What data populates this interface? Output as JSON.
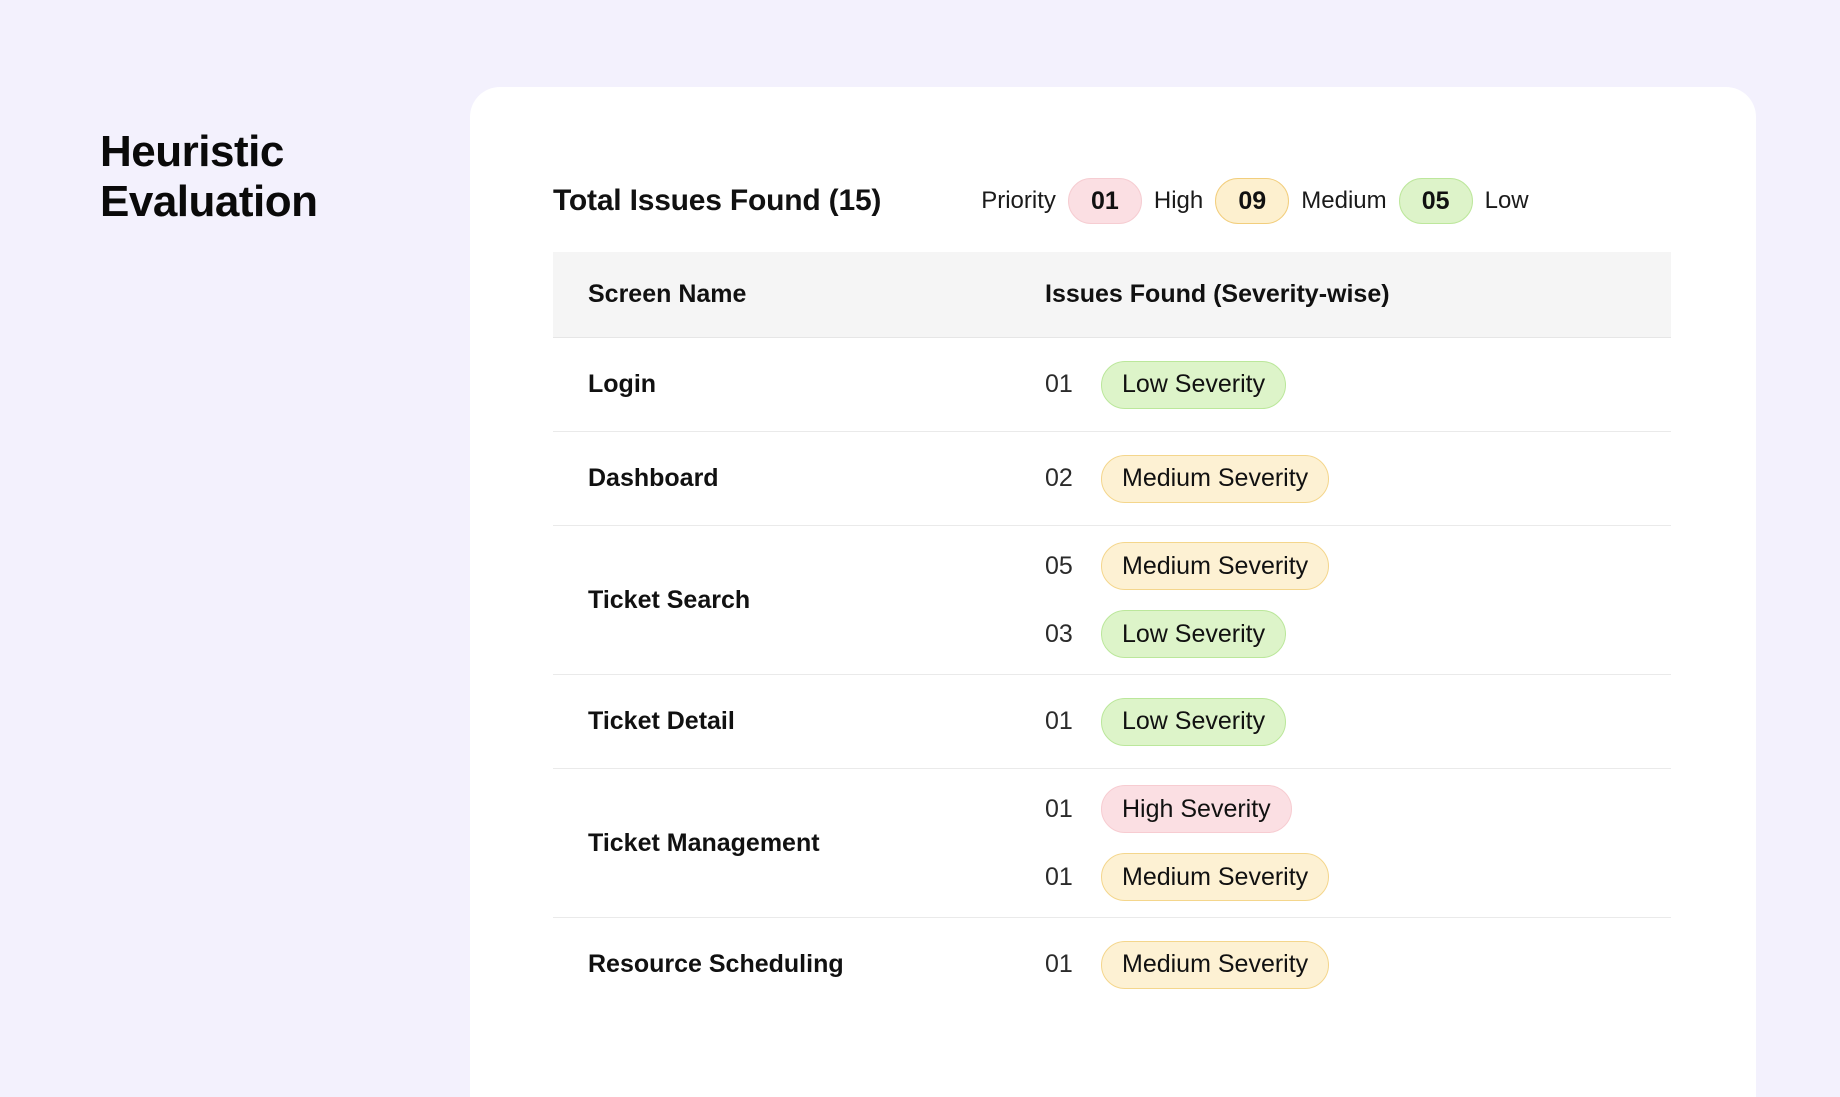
{
  "page": {
    "title": "Heuristic Evaluation",
    "background_color": "#F3F1FD"
  },
  "card": {
    "summary_title": "Total Issues Found (15)",
    "legend": {
      "label": "Priority",
      "items": [
        {
          "count": "01",
          "label": "High",
          "severity": "high",
          "color": "#FBDFE3"
        },
        {
          "count": "09",
          "label": "Medium",
          "severity": "medium",
          "color": "#FDF0CF"
        },
        {
          "count": "05",
          "label": "Low",
          "severity": "low",
          "color": "#DDF3C9"
        }
      ]
    },
    "table": {
      "headers": {
        "screen_name": "Screen Name",
        "issues_found": "Issues Found (Severity-wise)"
      },
      "rows": [
        {
          "screen": "Login",
          "issues": [
            {
              "count": "01",
              "label": "Low Severity",
              "severity": "low"
            }
          ]
        },
        {
          "screen": "Dashboard",
          "issues": [
            {
              "count": "02",
              "label": "Medium Severity",
              "severity": "medium"
            }
          ]
        },
        {
          "screen": "Ticket Search",
          "issues": [
            {
              "count": "05",
              "label": "Medium Severity",
              "severity": "medium"
            },
            {
              "count": "03",
              "label": "Low Severity",
              "severity": "low"
            }
          ]
        },
        {
          "screen": "Ticket Detail",
          "issues": [
            {
              "count": "01",
              "label": "Low Severity",
              "severity": "low"
            }
          ]
        },
        {
          "screen": "Ticket Management",
          "issues": [
            {
              "count": "01",
              "label": "High Severity",
              "severity": "high"
            },
            {
              "count": "01",
              "label": "Medium Severity",
              "severity": "medium"
            }
          ]
        },
        {
          "screen": "Resource Scheduling",
          "issues": [
            {
              "count": "01",
              "label": "Medium Severity",
              "severity": "medium"
            }
          ]
        }
      ]
    }
  }
}
